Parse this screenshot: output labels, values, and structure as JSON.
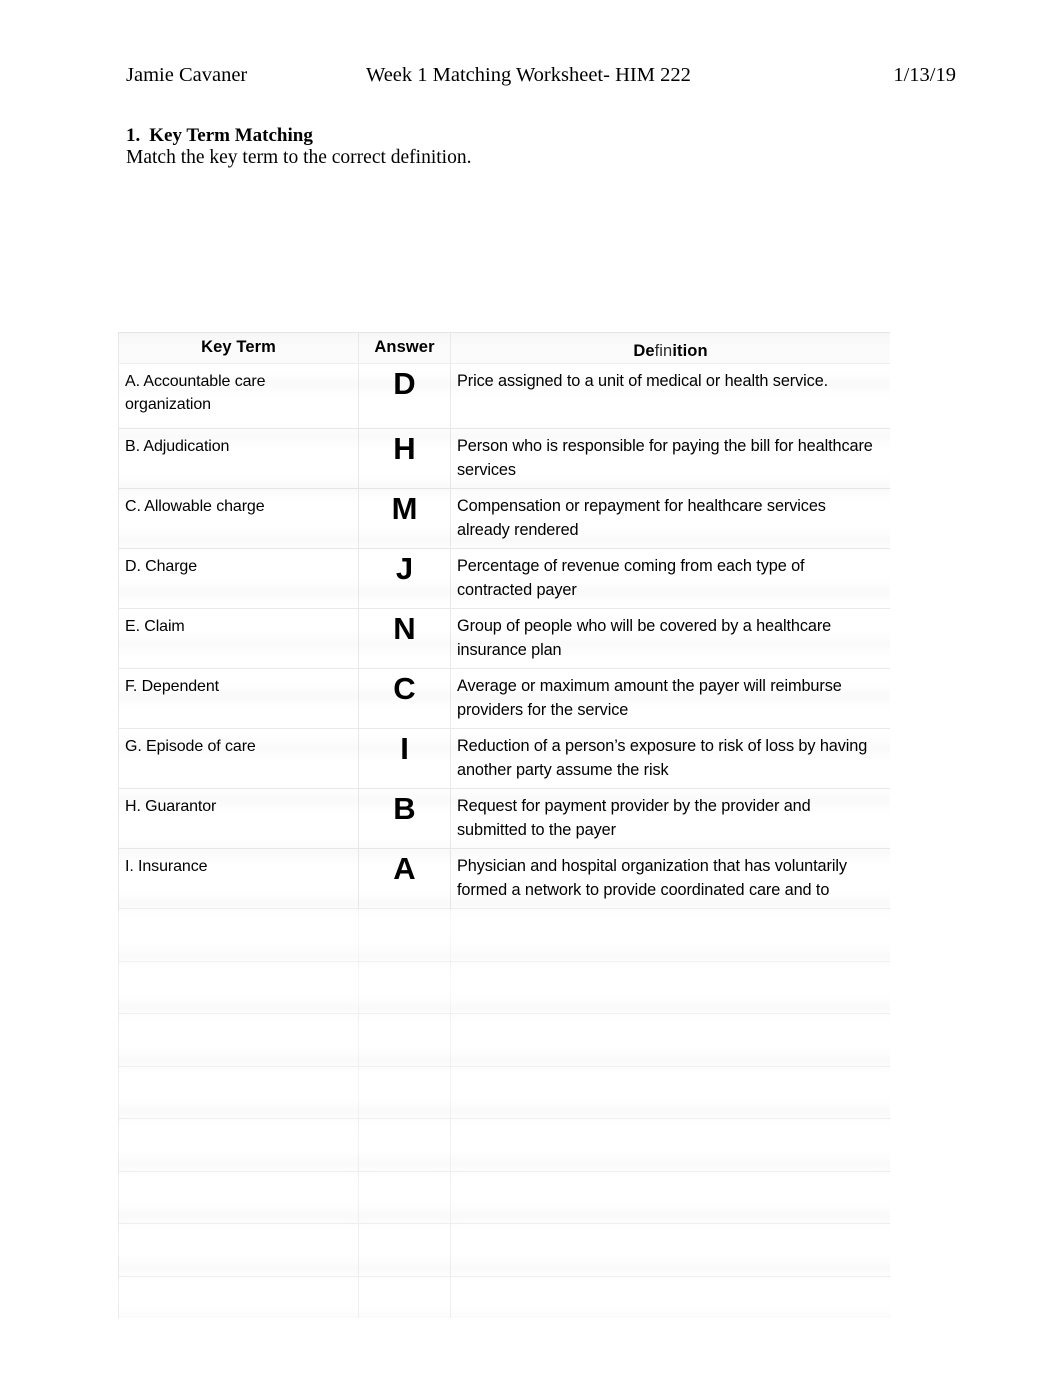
{
  "header": {
    "author": "Jamie Cavaner",
    "title": "Week 1 Matching Worksheet- HIM 222",
    "date": "1/13/19"
  },
  "section": {
    "number": "1.",
    "heading": "Key Term Matching",
    "instruction": "Match the key term to the correct definition."
  },
  "table": {
    "columns": {
      "key_term": "Key Term",
      "answer": "Answer",
      "definition_prefix": "De",
      "definition_mid": "fin",
      "definition_suffix": "ition"
    },
    "rows": [
      {
        "term": "A. Accountable care organization",
        "answer": "D",
        "definition": "Price assigned to a unit of medical or health service.",
        "blur": 0
      },
      {
        "term": "B. Adjudication",
        "answer": "H",
        "definition": "Person who is responsible for paying the bill for healthcare services",
        "blur": 0
      },
      {
        "term": "C. Allowable charge",
        "answer": "M",
        "definition": "Compensation or repayment for healthcare services already rendered",
        "blur": 0
      },
      {
        "term": "D. Charge",
        "answer": "J",
        "definition": "Percentage of revenue coming from each type of contracted payer",
        "blur": 0
      },
      {
        "term": "E. Claim",
        "answer": "N",
        "definition": "Group of people who will be covered by a healthcare insurance plan",
        "blur": 0
      },
      {
        "term": "F. Dependent",
        "answer": "C",
        "definition": "Average or maximum amount the payer will reimburse providers for the service",
        "blur": 0
      },
      {
        "term": "G. Episode of care",
        "answer": "I",
        "definition": "Reduction of a person’s exposure to risk of loss by having another party assume the risk",
        "blur": 0
      },
      {
        "term": "H. Guarantor",
        "answer": "B",
        "definition": "Request for payment provider by the provider and submitted to the payer",
        "blur": 0
      },
      {
        "term": "I. Insurance",
        "answer": "A",
        "definition": "Physician and hospital organization that has voluntarily formed a network to provide coordinated care and to",
        "blur": 0
      },
      {
        "term": "",
        "answer": "",
        "definition": "",
        "blur": 1
      },
      {
        "term": "",
        "answer": "",
        "definition": "",
        "blur": 2
      },
      {
        "term": "",
        "answer": "",
        "definition": "",
        "blur": 3
      },
      {
        "term": "",
        "answer": "",
        "definition": "",
        "blur": 3
      },
      {
        "term": "",
        "answer": "",
        "definition": "",
        "blur": 4
      },
      {
        "term": "",
        "answer": "",
        "definition": "",
        "blur": 4
      },
      {
        "term": "",
        "answer": "",
        "definition": "",
        "blur": 5
      },
      {
        "term": "",
        "answer": "",
        "definition": "",
        "blur": 5
      }
    ]
  }
}
